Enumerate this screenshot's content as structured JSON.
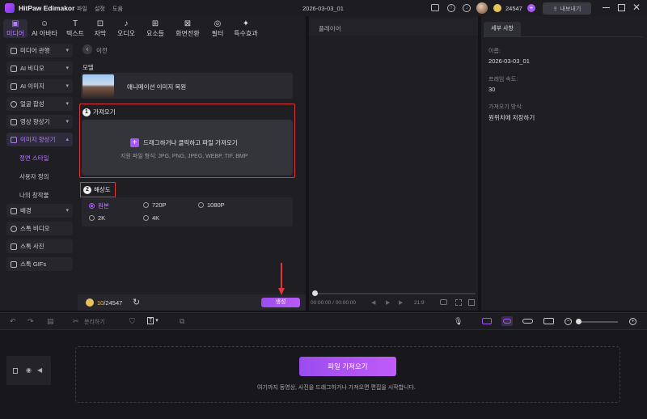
{
  "app": {
    "name": "HitPaw Edimakor",
    "menu": [
      "파일",
      "설정",
      "도움"
    ],
    "project_title": "2026-03-03_01",
    "credits": "24547",
    "export_label": "내보내기"
  },
  "tabs": [
    {
      "label": "미디어",
      "icon": "folder-icon"
    },
    {
      "label": "AI 아바타",
      "icon": "avatar-icon"
    },
    {
      "label": "텍스트",
      "icon": "text-icon"
    },
    {
      "label": "자막",
      "icon": "subtitle-icon"
    },
    {
      "label": "오디오",
      "icon": "audio-icon"
    },
    {
      "label": "요소들",
      "icon": "elements-icon"
    },
    {
      "label": "화면전환",
      "icon": "transition-icon"
    },
    {
      "label": "필터",
      "icon": "filter-icon"
    },
    {
      "label": "특수효과",
      "icon": "effects-icon"
    }
  ],
  "sidebar": {
    "items": [
      {
        "label": "미디어 관행"
      },
      {
        "label": "AI 비디오"
      },
      {
        "label": "AI  이미지"
      },
      {
        "label": "얼굴 합성"
      },
      {
        "label": "영상 향상기"
      },
      {
        "label": "이미지 향상기"
      }
    ],
    "sub_items": [
      "정면 스타일",
      "사용자 정의",
      "나의 창작물"
    ],
    "bottom_items": [
      {
        "label": "배경"
      },
      {
        "label": "스톡 비디오"
      },
      {
        "label": "스톡 사진"
      },
      {
        "label": "스톡 GIFs"
      }
    ]
  },
  "main": {
    "back_label": "이전",
    "model_label": "모델",
    "model_name": "애니메이션 이미지 복원",
    "step1": {
      "num": "1",
      "label": "가져오기"
    },
    "import_text": "드래그하거나 클릭하고 파일 가져오기",
    "import_formats": "지원 파일 형식: JPG, PNG, JPEG, WEBP, TIF, BMP",
    "step2": {
      "num": "2",
      "label": "해상도"
    },
    "resolutions": [
      "원본",
      "720P",
      "1080P",
      "2K",
      "4K"
    ],
    "selected_resolution": "원본",
    "credits_used": "10",
    "credits_total": "/24547",
    "generate_label": "생성"
  },
  "player": {
    "title": "플레이어",
    "time": "00:00:00 / 00:00:00",
    "ratio": "21:9"
  },
  "details": {
    "tab": "세부 사항",
    "name_label": "이름:",
    "name_value": "2026-03-03_01",
    "fps_label": "프레임 속도:",
    "fps_value": "30",
    "import_mode_label": "가져오기 방식:",
    "import_mode_value": "원위치에 저장하기"
  },
  "timeline": {
    "split_label": "분리하기",
    "import_button": "파일 가져오기",
    "drop_hint": "여기까지 동영상, 사진을 드래그하거나 가져오면 편집을 시작합니다."
  },
  "colors": {
    "accent": "#a855f7",
    "highlight": "#e0363b"
  }
}
